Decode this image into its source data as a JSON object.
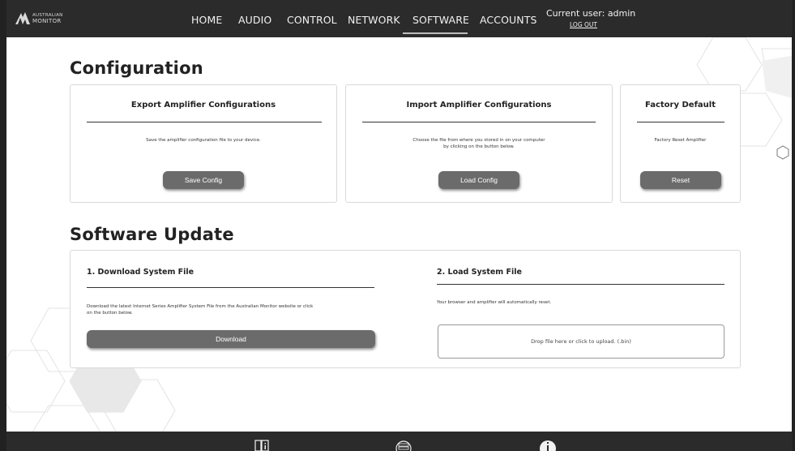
{
  "nav": {
    "logo_text_line1": "AUSTRALIAN",
    "logo_text_line2": "MONITOR",
    "items": [
      "HOME",
      "AUDIO",
      "CONTROL",
      "NETWORK",
      "SOFTWARE",
      "ACCOUNTS"
    ],
    "active": "SOFTWARE",
    "current_user": "Current user: admin",
    "logout": "LOG OUT"
  },
  "configuration": {
    "heading": "Configuration",
    "export": {
      "title": "Export Amplifier Configurations",
      "text": "Save the amplifier configuration file to your device.",
      "button": "Save Config"
    },
    "import": {
      "title": "Import Amplifier Configurations",
      "text_line1": "Choose the file from where you stored in on your computer",
      "text_line2": "by clicking on the button below.",
      "button": "Load Config"
    },
    "factory": {
      "title": "Factory Default",
      "text": "Factory Reset Amplifier",
      "button": "Reset"
    }
  },
  "software_update": {
    "heading": "Software Update",
    "download": {
      "title": "1. Download System File",
      "text_line1": "Download the latest Internet Series Amplifier System File from the Australian Monitor website or click",
      "text_line2": "on the button below.",
      "button": "Download"
    },
    "load": {
      "title": "2. Load System File",
      "text": "Your browser and amplifier will automatically reset.",
      "dropzone": "Drop file here or click to upload. (.bin)"
    }
  },
  "footer": {
    "icons": [
      "manual-icon",
      "device-icon",
      "info-icon"
    ]
  },
  "colors": {
    "nav_bg": "#2b2b2b",
    "button_bg": "#6b6b6b"
  }
}
